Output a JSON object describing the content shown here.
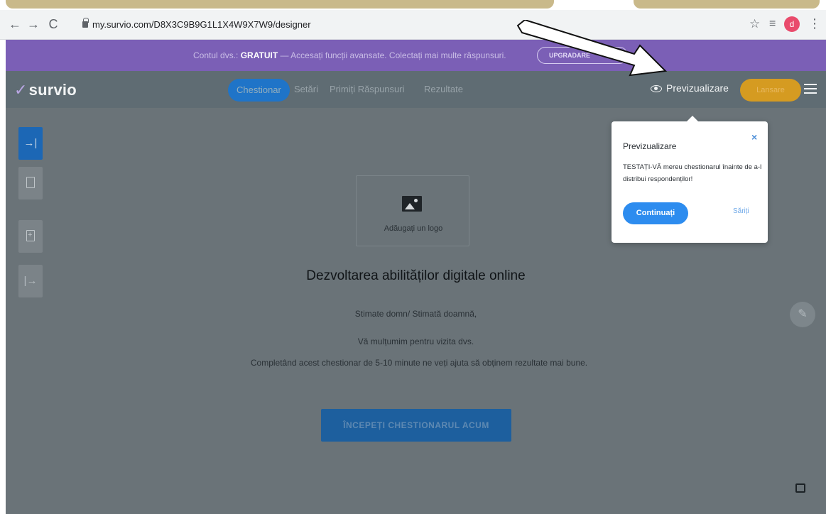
{
  "browser": {
    "url": "my.survio.com/D8X3C9B9G1L1X4W9X7W9/designer",
    "profile_initial": "d"
  },
  "promo": {
    "text_prefix": "Contul dvs.:",
    "plan": "GRATUIT",
    "text_suffix": "— Accesați funcții avansate. Colectați mai multe răspunsuri.",
    "button": "UPGRADARE",
    "color": "#7b5fb6"
  },
  "header": {
    "logo": "survio",
    "tabs": [
      "Chestionar",
      "Setări",
      "Primiți Răspunsuri",
      "Rezultate"
    ],
    "active_tab": "Chestionar",
    "preview": "Previzualizare",
    "publish": "Lansare",
    "accent": "#1f74c8"
  },
  "sidebar": {
    "items": [
      {
        "icon": "sign-in-icon",
        "active": true
      },
      {
        "icon": "page-icon",
        "active": false
      },
      {
        "icon": "add-page-icon",
        "active": false
      },
      {
        "icon": "sign-out-icon",
        "active": false
      }
    ]
  },
  "survey": {
    "logo_placeholder": "Adăugați un logo",
    "title": "Dezvoltarea abilităților digitale online",
    "greeting": "Stimate domn/ Stimată doamnă,",
    "thanks": "Vă mulțumim pentru vizita dvs.",
    "intro": "Completând acest chestionar de 5-10 minute ne veți ajuta să obținem rezultate mai bune.",
    "start_button": "ÎNCEPEȚI CHESTIONARUL ACUM"
  },
  "tooltip": {
    "close": "×",
    "title": "Previzualizare",
    "body": "TESTAȚI-VĂ mereu chestionarul înainte de a-l distribui respondenților!",
    "continue": "Continuați",
    "skip": "Săriți"
  }
}
